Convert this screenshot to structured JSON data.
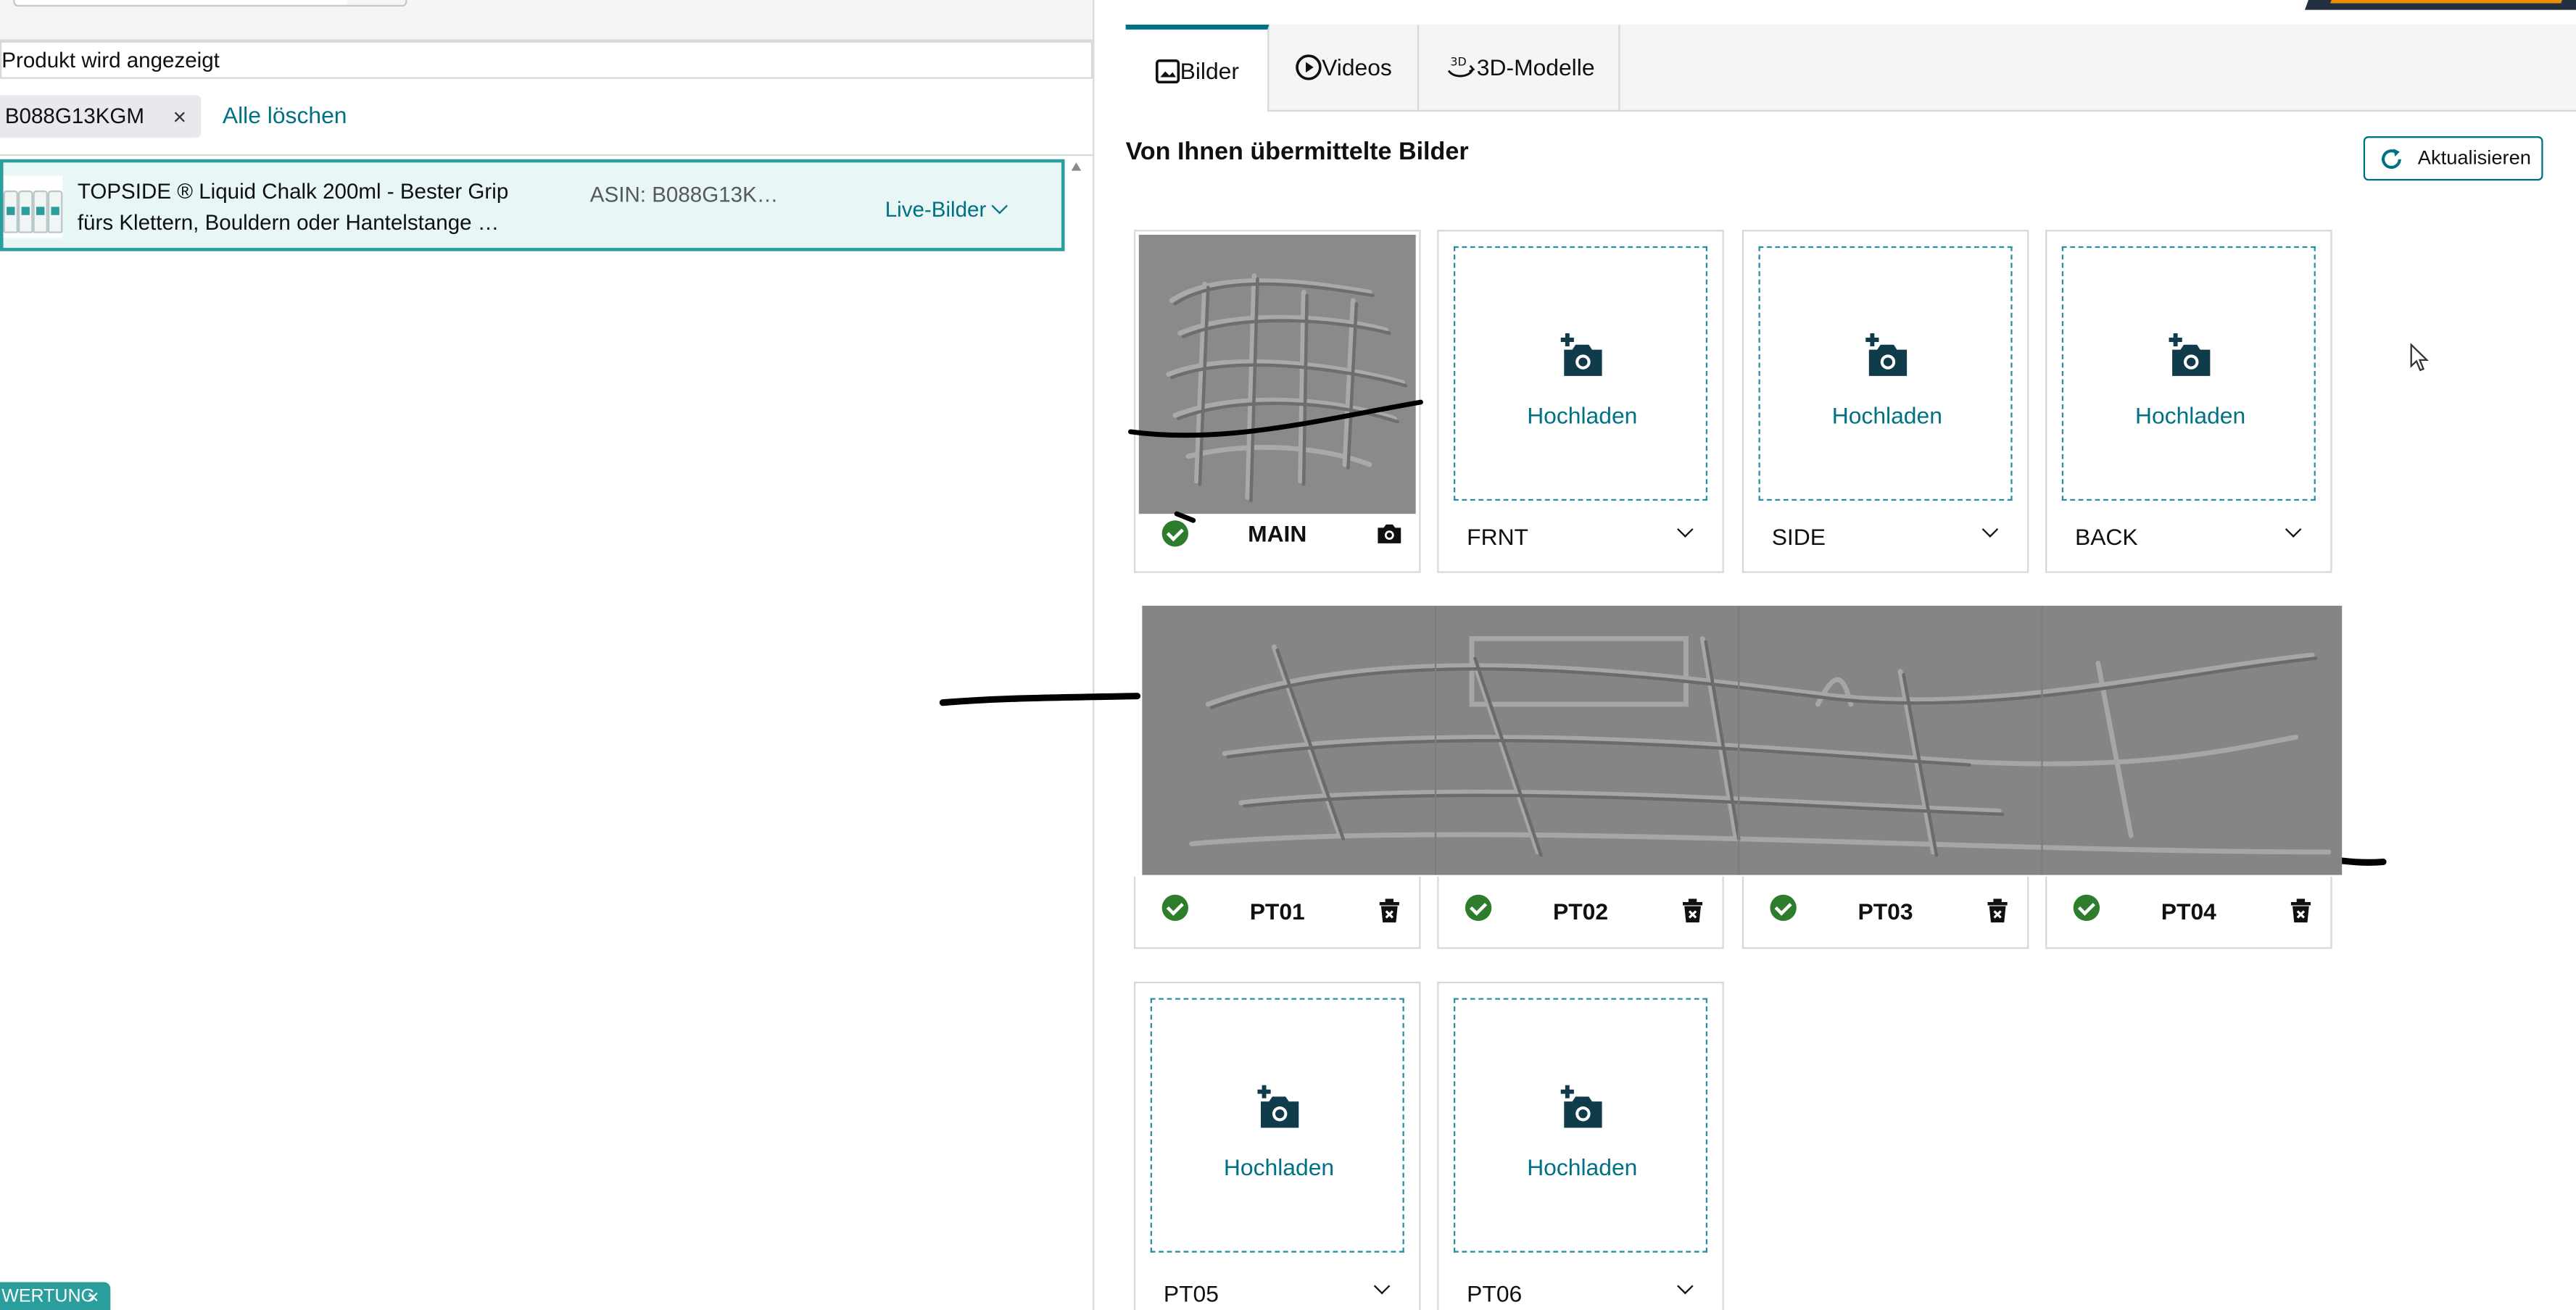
{
  "left_panel": {
    "filter_text": "Produkt wird angezeigt",
    "chip_label": "B088G13KGM",
    "chip_remove": "×",
    "clear_all": "Alle löschen",
    "result": {
      "title_line1": "TOPSIDE ® Liquid Chalk 200ml - Bester Grip",
      "title_line2": "fürs Klettern, Bouldern oder Hantelstange …",
      "asin": "ASIN: B088G13K…",
      "view_select": "Live-Bilder"
    },
    "bottom_tag": "WERTUNG",
    "bottom_tag_remove": "×"
  },
  "tabs": [
    {
      "label": "Bilder",
      "icon": "image-icon",
      "active": true
    },
    {
      "label": "Videos",
      "icon": "play-icon",
      "active": false
    },
    {
      "label": "3D-Modelle",
      "icon": "3d-icon",
      "active": false
    }
  ],
  "main": {
    "section_title": "Von Ihnen übermittelte Bilder",
    "refresh_label": "Aktualisieren",
    "upload_label": "Hochladen",
    "slots": {
      "main": {
        "code": "MAIN",
        "status": "uploaded",
        "action_icon": "camera-icon"
      },
      "frnt": {
        "code": "FRNT",
        "status": "empty"
      },
      "side": {
        "code": "SIDE",
        "status": "empty"
      },
      "back": {
        "code": "BACK",
        "status": "empty"
      },
      "pt01": {
        "code": "PT01",
        "status": "uploaded",
        "action_icon": "trash-icon"
      },
      "pt02": {
        "code": "PT02",
        "status": "uploaded",
        "action_icon": "trash-icon"
      },
      "pt03": {
        "code": "PT03",
        "status": "uploaded",
        "action_icon": "trash-icon"
      },
      "pt04": {
        "code": "PT04",
        "status": "uploaded",
        "action_icon": "trash-icon"
      },
      "pt05": {
        "code": "PT05",
        "status": "empty"
      },
      "pt06": {
        "code": "PT06",
        "status": "empty"
      }
    }
  },
  "colors": {
    "accent": "#007185",
    "selected_row_bg": "#e8f6f6",
    "selected_row_border": "#2a9d9d",
    "success": "#2d7d2d",
    "header_dark": "#232f3e",
    "header_orange": "#ff9900"
  }
}
